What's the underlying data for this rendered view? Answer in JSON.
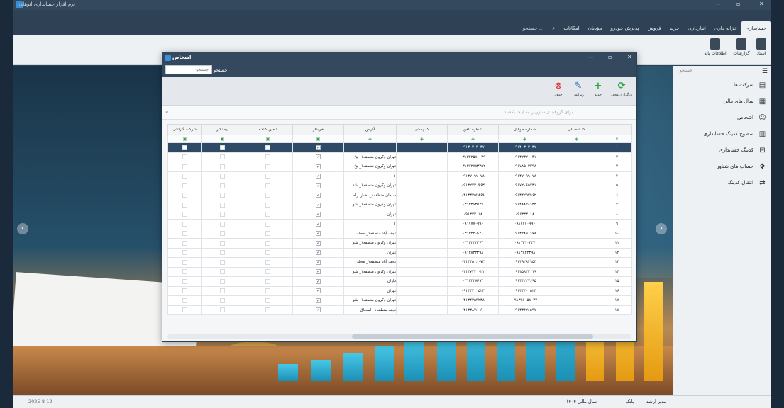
{
  "app": {
    "title": "نرم افزار حسابداری اتوهای",
    "window_controls": [
      "—",
      "▫",
      "✕"
    ]
  },
  "menu": {
    "tabs": [
      {
        "label": "حسابداری",
        "active": true
      },
      {
        "label": "خزانه داری"
      },
      {
        "label": "انبارداری"
      },
      {
        "label": "خرید"
      },
      {
        "label": "فروش"
      },
      {
        "label": "پذیرش خودرو"
      },
      {
        "label": "مؤدیان"
      },
      {
        "label": "امکانات"
      },
      {
        "label": "⌕"
      },
      {
        "label": "جستجو ..."
      }
    ]
  },
  "ribbon": {
    "buttons": [
      "اسناد",
      "گزارشات",
      "اطلاعات پایه"
    ]
  },
  "sidebar": {
    "search_placeholder": "جستجو",
    "items": [
      {
        "label": "شرکت ها",
        "icon": "building-icon"
      },
      {
        "label": "سال های مالی",
        "icon": "calendar-icon"
      },
      {
        "label": "اشخاص",
        "icon": "people-icon"
      },
      {
        "label": "سطوح کدینگ حسابداری",
        "icon": "levels-icon"
      },
      {
        "label": "کدینگ حسابداری",
        "icon": "tree-icon"
      },
      {
        "label": "حساب های شناور",
        "icon": "float-icon"
      },
      {
        "label": "انتقال کدینگ",
        "icon": "transfer-icon"
      }
    ]
  },
  "statusbar": {
    "user": "مدیر ارشد",
    "bank": "بانک",
    "fiscal_year": "سال مالی ۱۴۰۴",
    "date": "2025-8-12"
  },
  "dialog": {
    "title": "اشخاص",
    "search_label": "جستجو",
    "search_placeholder": "جستجو",
    "toolbar": {
      "refresh": "بارگذاری مجدد",
      "add": "جدید",
      "edit": "ویرایش",
      "delete": "حذف"
    },
    "group_hint": "برای گروهبندی ستون را به اینجا بکشید",
    "columns": [
      "کد تفصیلی",
      "شماره موبایل",
      "شماره تلفن",
      "کد پستی",
      "آدرس",
      "خریدار",
      "تامین کننده",
      "پیمانکار",
      "شرکت گارانتی"
    ],
    "rows": [
      {
        "n": "۱",
        "mobile": "۰۹۱۳۰۳۰۳۰۳۷",
        "phone": "۰۹۱۳۰۳۰۳۰۳۷",
        "postal": "",
        "address": "-",
        "buyer": true
      },
      {
        "n": "۲",
        "mobile": "۰۹۱۳۲۳۲۰۰۴۱",
        "phone": "۰۳۱۳۴۲۵۸۰۰۳۹",
        "postal": "",
        "address": "تهران وکرون منطقه۱_ بخ",
        "buyer": true
      },
      {
        "n": "۳",
        "mobile": "۰۹۱۷۸۵۰۳۲۹۸",
        "phone": "۰۳۱۳۷۲۷۸۳۳۵۲",
        "postal": "",
        "address": "تهران وکرون منطقه۱_ بخ",
        "buyer": true
      },
      {
        "n": "۴",
        "mobile": "۰۹۱۳۷۰۹۹۰۷۸",
        "phone": "۰۹۱۳۷۰۹۹۰۷۸",
        "postal": "",
        "address": "۱",
        "buyer": true
      },
      {
        "n": "۵",
        "mobile": "۰۹۱۷۲۰۶۵۷۳۱",
        "phone": "۰۹۱۳۲۲۳۰۹۶۳",
        "postal": "",
        "address": "تهران وکرون منطقه۱_ شد",
        "buyer": true
      },
      {
        "n": "۶",
        "mobile": "۰۹۱۳۴۲۵۳۹۶۲",
        "phone": "۰۳۱۳۳۳۵۴۸۶۹",
        "postal": "",
        "address": "سامان منطقه۱_ بخش راه",
        "buyer": true
      },
      {
        "n": "۷",
        "mobile": "۰۹۱۳۸۸۲۸۶۳۴",
        "phone": "۰۳۱۳۳۶۳۷۳۷",
        "postal": "",
        "address": "تهران وکرون منطقه۱_ شو",
        "buyer": true
      },
      {
        "n": "۸",
        "mobile": "۰۹۱۳۳۳۰۱۸",
        "phone": "۰۹۱۳۳۳۰۱۸",
        "postal": "",
        "address": "تهران",
        "buyer": true
      },
      {
        "n": "۹",
        "mobile": "۰۹۱۷۷۷۰۹۹۶",
        "phone": "۰۹۱۷۷۷۰۹۹۶",
        "postal": "",
        "address": "۱",
        "buyer": true
      },
      {
        "n": "۱۰",
        "mobile": "۰۹۱۳۲۸۹۰۶۷۸",
        "phone": "۰۳۱۳۲۲۰۶۲۱",
        "postal": "",
        "address": "نجف آباد منطقه۱_ محله",
        "buyer": true
      },
      {
        "n": "۱۱",
        "mobile": "۰۹۱۳۳۱۰۳۲۷",
        "phone": "۰۳۱۳۲۲۲۳۶۴",
        "postal": "",
        "address": "تهران وکرون منطقه۱_ شو",
        "buyer": true
      },
      {
        "n": "۱۲",
        "mobile": "۰۹۱۳۸۳۳۳۹۸",
        "phone": "۰۹۱۳۸۳۳۳۹۸",
        "postal": "",
        "address": "تهران",
        "buyer": true
      },
      {
        "n": "۱۳",
        "mobile": "۰۹۱۳۹۲۸۴۹۵۳",
        "phone": "۰۳۱۳۴۵۰۶۰۷۳",
        "postal": "",
        "address": "نجف آباد منطقه۱_ محله",
        "buyer": true
      },
      {
        "n": "۱۴",
        "mobile": "۰۹۱۳۵۸۴۲۰۱۹",
        "phone": "۰۳۱۳۷۲۴۰۰۲۱",
        "postal": "",
        "address": "تهران وکرون منطقه۱_ شو",
        "buyer": true
      },
      {
        "n": "۱۵",
        "mobile": "۰۹۱۳۳۲۲۷۶۹۵",
        "phone": "۰۳۱۳۳۲۷۶۹۳",
        "postal": "",
        "address": "داران",
        "buyer": true
      },
      {
        "n": "۱۶",
        "mobile": "۰۹۱۳۳۳۰۰۵۲۳",
        "phone": "۰۹۱۳۳۳۰۰۵۲۳",
        "postal": "",
        "address": "تهران",
        "buyer": true
      },
      {
        "n": "۱۷",
        "mobile": "۰۹۱۳۸۷۰۵۸۰۳۲",
        "phone": "۰۳۱۳۴۳۵۳۲۳۸",
        "postal": "",
        "address": "تهران وکرون منطقه۱_ شو",
        "buyer": true
      },
      {
        "n": "۱۸",
        "mobile": "۰۹۱۳۳۴۲۶۵۹۷",
        "phone": "۰۳۱۳۳۸۷۶۰۶۰",
        "postal": "",
        "address": "نجف منطقه۱_ اسحاق",
        "buyer": true
      }
    ]
  },
  "colors": {
    "header": "#34495e",
    "accent_green": "#2aa84a",
    "accent_red": "#e03a3a",
    "accent_blue": "#2f6fb8",
    "selected_row": "#2e4a66"
  }
}
